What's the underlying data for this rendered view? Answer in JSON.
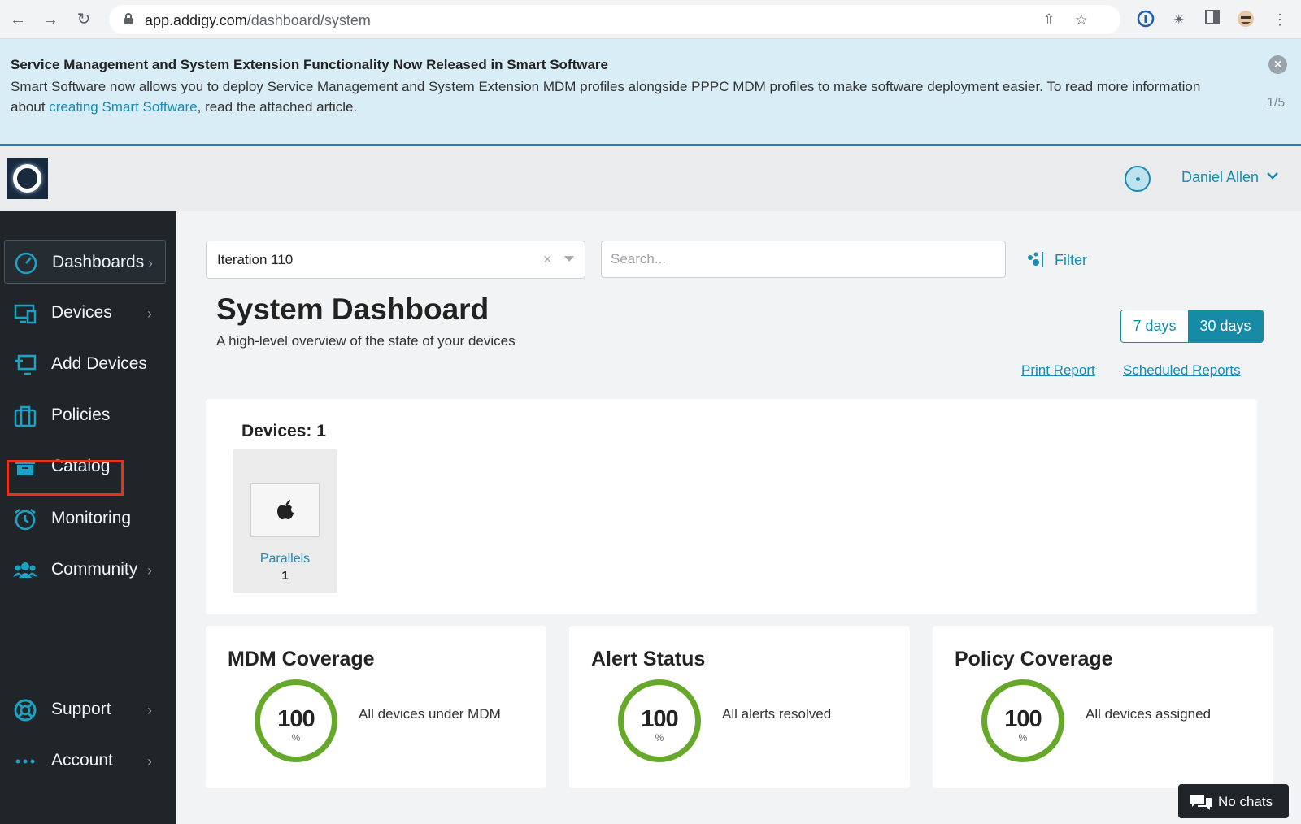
{
  "browser": {
    "url_host": "app.addigy.com",
    "url_path": "/dashboard/system"
  },
  "banner": {
    "title": "Service Management and System Extension Functionality Now Released in Smart Software",
    "text_before": "Smart Software now allows you to deploy Service Management and System Extension MDM profiles alongside PPPC MDM profiles to make software deployment easier. To read more information about ",
    "link_text": "creating Smart Software",
    "text_after": ", read the attached article.",
    "pager": "1/5"
  },
  "header": {
    "user_name": "Daniel Allen"
  },
  "sidebar": {
    "items": [
      {
        "label": "Dashboards",
        "icon": "speedometer-icon",
        "chevron": true
      },
      {
        "label": "Devices",
        "icon": "devices-icon",
        "chevron": true
      },
      {
        "label": "Add Devices",
        "icon": "add-device-icon",
        "chevron": false
      },
      {
        "label": "Policies",
        "icon": "briefcase-icon",
        "chevron": false
      },
      {
        "label": "Catalog",
        "icon": "archive-box-icon",
        "chevron": false
      },
      {
        "label": "Monitoring",
        "icon": "alarm-clock-icon",
        "chevron": false
      },
      {
        "label": "Community",
        "icon": "users-icon",
        "chevron": true
      },
      {
        "label": "Support",
        "icon": "lifebuoy-icon",
        "chevron": true
      },
      {
        "label": "Account",
        "icon": "ellipsis-icon",
        "chevron": true
      }
    ]
  },
  "toolbar": {
    "selected_policy": "Iteration 110",
    "search_placeholder": "Search...",
    "filter_label": "Filter"
  },
  "page": {
    "title": "System Dashboard",
    "subtitle": "A high-level overview of the state of your devices",
    "range_7": "7 days",
    "range_30": "30 days",
    "selected_range": "30 days",
    "print_report": "Print Report",
    "scheduled_reports": "Scheduled Reports"
  },
  "devices": {
    "title": "Devices: 1",
    "tiles": [
      {
        "name": "Parallels",
        "count": "1",
        "icon": "apple-icon"
      }
    ]
  },
  "stats": [
    {
      "title": "MDM Coverage",
      "value": "100",
      "unit": "%",
      "description": "All devices under MDM"
    },
    {
      "title": "Alert Status",
      "value": "100",
      "unit": "%",
      "description": "All alerts resolved"
    },
    {
      "title": "Policy Coverage",
      "value": "100",
      "unit": "%",
      "description": "All devices assigned"
    }
  ],
  "chat": {
    "label": "No chats"
  },
  "colors": {
    "accent": "#1b8bb4",
    "sidebar_bg": "#1f2529",
    "gauge_green": "#66a829",
    "banner_bg": "#d9edf7"
  }
}
